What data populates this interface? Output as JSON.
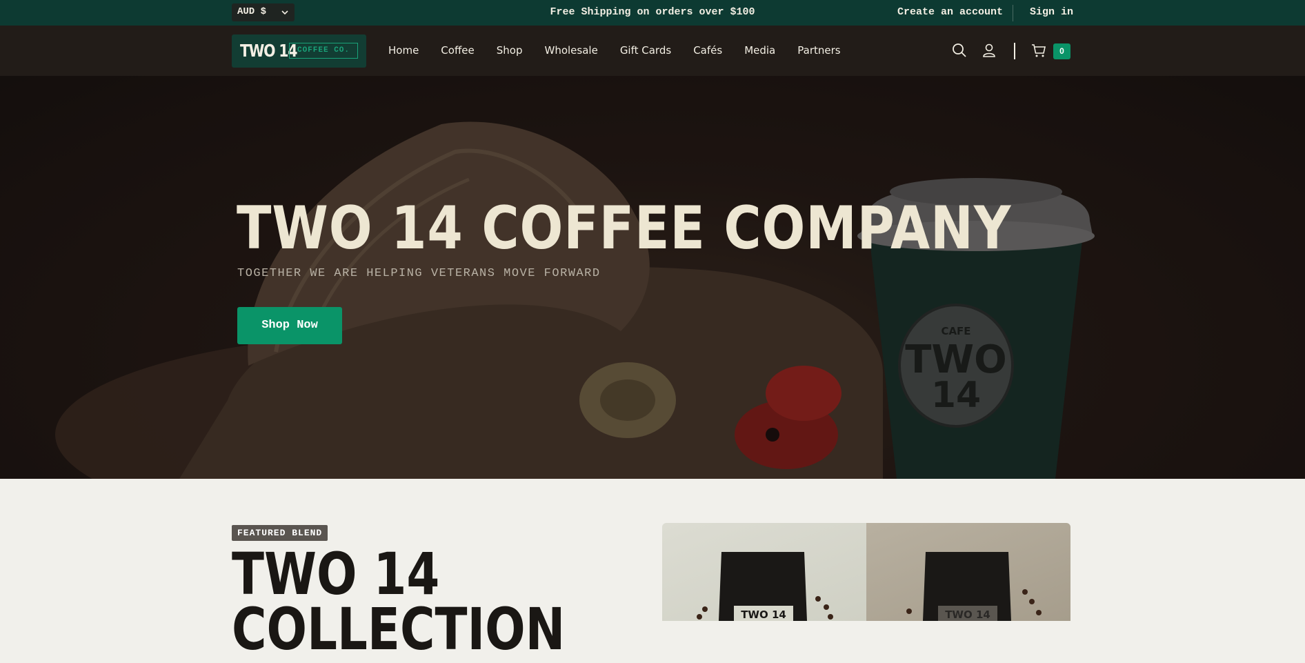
{
  "announcement": {
    "currency": "AUD $",
    "message": "Free Shipping on orders over $100",
    "create_account": "Create an account",
    "sign_in": "Sign in"
  },
  "header": {
    "logo_main": "TWO 14",
    "logo_sub": "COFFEE CO.",
    "nav": [
      "Home",
      "Coffee",
      "Shop",
      "Wholesale",
      "Gift Cards",
      "Cafés",
      "Media",
      "Partners"
    ],
    "cart_count": "0"
  },
  "hero": {
    "title": "TWO 14 COFFEE COMPANY",
    "subtitle": "TOGETHER WE ARE HELPING VETERANS MOVE FORWARD",
    "cta": "Shop Now",
    "cup_small_text": "CAFE",
    "cup_big_text_1": "TWO",
    "cup_big_text_2": "14"
  },
  "featured": {
    "badge": "FEATURED BLEND",
    "title_line1": "TWO 14",
    "title_line2": "COLLECTION",
    "bag_label": "TWO 14"
  },
  "colors": {
    "announce_bg": "#0d3a32",
    "header_bg": "#221c18",
    "accent_green": "#0a9468",
    "hero_text": "#ede6d2"
  }
}
